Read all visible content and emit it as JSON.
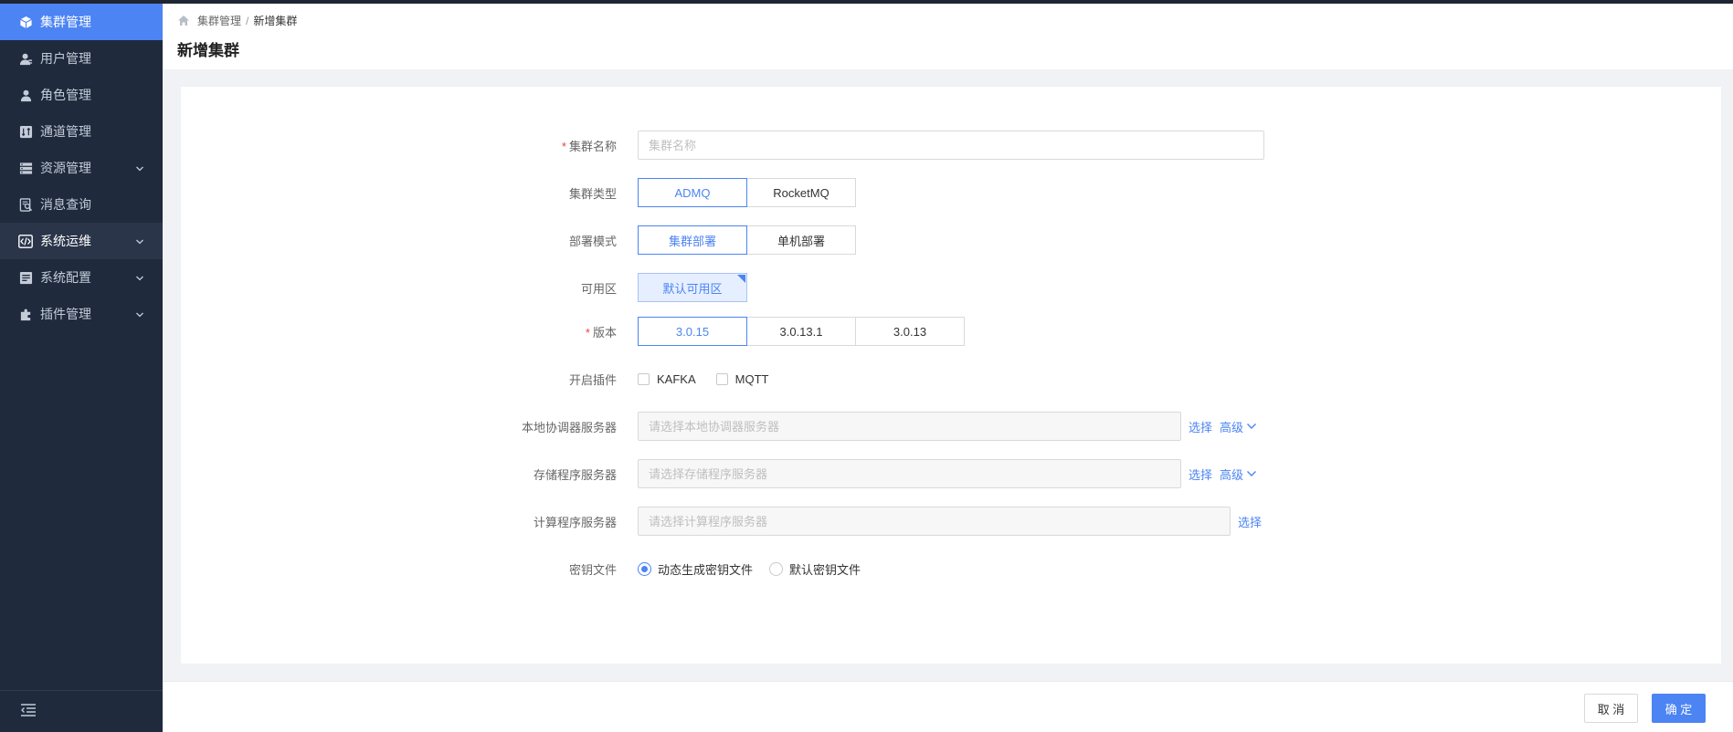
{
  "sidebar": {
    "items": [
      {
        "label": "集群管理",
        "icon": "cube-icon"
      },
      {
        "label": "用户管理",
        "icon": "user-icon"
      },
      {
        "label": "角色管理",
        "icon": "role-icon"
      },
      {
        "label": "通道管理",
        "icon": "channel-icon"
      },
      {
        "label": "资源管理",
        "icon": "server-icon"
      },
      {
        "label": "消息查询",
        "icon": "search-doc-icon"
      },
      {
        "label": "系统运维",
        "icon": "code-icon"
      },
      {
        "label": "系统配置",
        "icon": "config-icon"
      },
      {
        "label": "插件管理",
        "icon": "puzzle-icon"
      }
    ],
    "active_index": 0,
    "collapse_icon": "collapse-menu-icon"
  },
  "header": {
    "breadcrumb": {
      "home_icon": "home-icon",
      "parent": "集群管理",
      "separator": "/",
      "current": "新增集群"
    },
    "title": "新增集群"
  },
  "form": {
    "cluster_name": {
      "label": "集群名称",
      "required": true,
      "placeholder": "集群名称",
      "value": ""
    },
    "cluster_type": {
      "label": "集群类型",
      "options": [
        "ADMQ",
        "RocketMQ"
      ],
      "selected": "ADMQ"
    },
    "deploy_mode": {
      "label": "部署模式",
      "options": [
        "集群部署",
        "单机部署"
      ],
      "selected": "集群部署"
    },
    "zone": {
      "label": "可用区",
      "option": "默认可用区"
    },
    "version": {
      "label": "版本",
      "required": true,
      "options": [
        "3.0.15",
        "3.0.13.1",
        "3.0.13"
      ],
      "selected": "3.0.15"
    },
    "plugins": {
      "label": "开启插件",
      "options": [
        "KAFKA",
        "MQTT"
      ]
    },
    "local_coordinator": {
      "label": "本地协调器服务器",
      "placeholder": "请选择本地协调器服务器",
      "select": "选择",
      "advanced": "高级"
    },
    "storage_server": {
      "label": "存储程序服务器",
      "placeholder": "请选择存储程序服务器",
      "select": "选择",
      "advanced": "高级"
    },
    "compute_server": {
      "label": "计算程序服务器",
      "placeholder": "请选择计算程序服务器",
      "select": "选择"
    },
    "key_file": {
      "label": "密钥文件",
      "options": [
        "动态生成密钥文件",
        "默认密钥文件"
      ],
      "selected": "动态生成密钥文件"
    }
  },
  "footer": {
    "cancel": "取 消",
    "ok": "确 定"
  },
  "colors": {
    "accent": "#4c84f3",
    "sidebar_bg": "#1f2a3d",
    "required": "#e64340"
  }
}
